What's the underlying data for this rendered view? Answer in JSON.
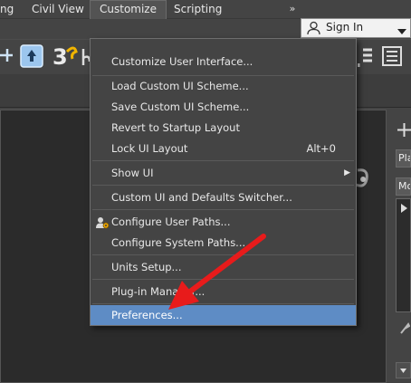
{
  "menubar": {
    "items": [
      {
        "label": "ng"
      },
      {
        "label": "Civil View"
      },
      {
        "label": "Customize"
      },
      {
        "label": "Scripting"
      }
    ],
    "overflow_label": "»",
    "signin_label": "Sign In"
  },
  "toolbar": {
    "snap_label": "3"
  },
  "command_panel": {
    "field1": "Pla",
    "field2": "Mo"
  },
  "customize_menu": {
    "items": [
      {
        "label": "Customize User Interface..."
      },
      {
        "label": "Load Custom UI Scheme..."
      },
      {
        "label": "Save Custom UI Scheme..."
      },
      {
        "label": "Revert to Startup Layout"
      },
      {
        "label": "Lock UI Layout",
        "shortcut": "Alt+0"
      },
      {
        "label": "Show UI",
        "submenu_arrow": "▶"
      },
      {
        "label": "Custom UI and Defaults Switcher..."
      },
      {
        "label": "Configure User Paths...",
        "icon": "user-gear-icon"
      },
      {
        "label": "Configure System Paths..."
      },
      {
        "label": "Units Setup..."
      },
      {
        "label": "Plug-in Manager..."
      },
      {
        "label": "Preferences..."
      }
    ]
  },
  "colors": {
    "highlight": "#5e8cc5",
    "annotation_arrow": "#e81b1b"
  }
}
